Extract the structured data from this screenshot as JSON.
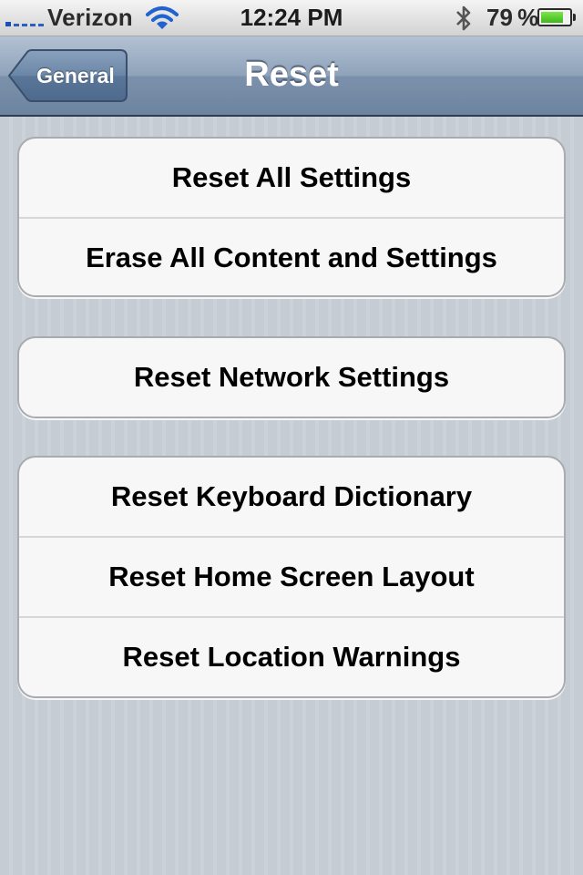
{
  "status_bar": {
    "carrier": "Verizon",
    "time": "12:24 PM",
    "battery_text": "79 %",
    "battery_level": 0.79,
    "icons": [
      "signal-icon",
      "wifi-icon",
      "bluetooth-icon",
      "battery-icon"
    ]
  },
  "nav": {
    "back_label": "General",
    "title": "Reset"
  },
  "groups": [
    {
      "items": [
        {
          "label": "Reset All Settings"
        },
        {
          "label": "Erase All Content and Settings"
        }
      ]
    },
    {
      "items": [
        {
          "label": "Reset Network Settings"
        }
      ]
    },
    {
      "items": [
        {
          "label": "Reset Keyboard Dictionary"
        },
        {
          "label": "Reset Home Screen Layout"
        },
        {
          "label": "Reset Location Warnings"
        }
      ]
    }
  ]
}
